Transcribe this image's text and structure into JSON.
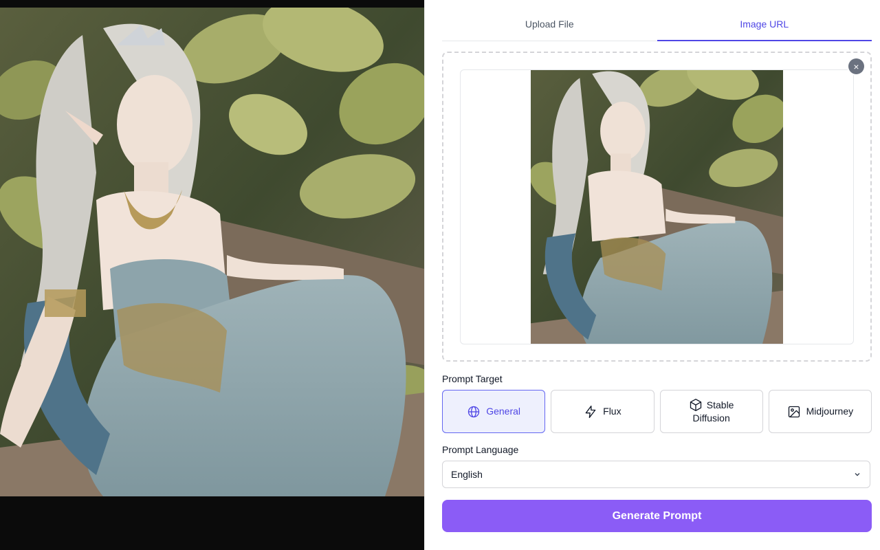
{
  "tabs": [
    {
      "label": "Upload File",
      "active": false
    },
    {
      "label": "Image URL",
      "active": true
    }
  ],
  "image_preview": {
    "subject": "elf woman in blue gown seated in jungle garden",
    "remove_symbol": "×"
  },
  "prompt_target": {
    "label": "Prompt Target",
    "options": [
      {
        "label": "General",
        "icon": "globe-icon",
        "selected": true
      },
      {
        "label": "Flux",
        "icon": "lightning-icon",
        "selected": false
      },
      {
        "label_line1": "Stable",
        "label_line2": "Diffusion",
        "icon": "cube-icon",
        "selected": false
      },
      {
        "label": "Midjourney",
        "icon": "image-icon",
        "selected": false
      }
    ]
  },
  "prompt_language": {
    "label": "Prompt Language",
    "selected": "English"
  },
  "generate_button": {
    "label": "Generate Prompt"
  },
  "colors": {
    "accent": "#4f46e5",
    "button": "#8b5cf6",
    "selected_bg": "#eef0fd"
  }
}
